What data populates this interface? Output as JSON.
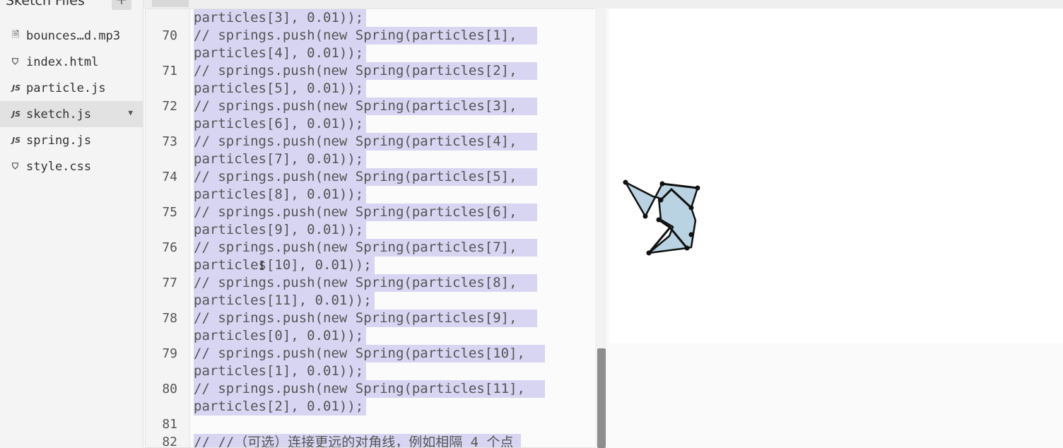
{
  "sidebar": {
    "title": "Sketch Files",
    "add_label": "+",
    "files": [
      {
        "name": "bounces…d.mp3",
        "icon": "file-icon",
        "glyph": "🗎",
        "selected": false
      },
      {
        "name": "index.html",
        "icon": "html5-icon",
        "glyph": "⛉",
        "selected": false
      },
      {
        "name": "particle.js",
        "icon": "js-icon",
        "glyph": "JS",
        "selected": false
      },
      {
        "name": "sketch.js",
        "icon": "js-icon",
        "glyph": "JS",
        "selected": true
      },
      {
        "name": "spring.js",
        "icon": "js-icon",
        "glyph": "JS",
        "selected": false
      },
      {
        "name": "style.css",
        "icon": "css3-icon",
        "glyph": "⛉",
        "selected": false
      }
    ],
    "options_glyph": "▼"
  },
  "editor": {
    "first_partial_line": "particles[3], 0.01));",
    "lines": [
      {
        "number": "70",
        "l1": "// springs.push(new Spring(particles[1],",
        "l2": "particles[4], 0.01));"
      },
      {
        "number": "71",
        "l1": "// springs.push(new Spring(particles[2],",
        "l2": "particles[5], 0.01));"
      },
      {
        "number": "72",
        "l1": "// springs.push(new Spring(particles[3],",
        "l2": "particles[6], 0.01));"
      },
      {
        "number": "73",
        "l1": "// springs.push(new Spring(particles[4],",
        "l2": "particles[7], 0.01));"
      },
      {
        "number": "74",
        "l1": "// springs.push(new Spring(particles[5],",
        "l2": "particles[8], 0.01));"
      },
      {
        "number": "75",
        "l1": "// springs.push(new Spring(particles[6],",
        "l2": "particles[9], 0.01));"
      },
      {
        "number": "76",
        "l1": "// springs.push(new Spring(particles[7],",
        "l2": "particles[10], 0.01));"
      },
      {
        "number": "77",
        "l1": "// springs.push(new Spring(particles[8],",
        "l2": "particles[11], 0.01));"
      },
      {
        "number": "78",
        "l1": "// springs.push(new Spring(particles[9],",
        "l2": "particles[0], 0.01));"
      },
      {
        "number": "79",
        "l1": "// springs.push(new Spring(particles[10],",
        "l2": "particles[1], 0.01));"
      },
      {
        "number": "80",
        "l1": "// springs.push(new Spring(particles[11],",
        "l2": "particles[2], 0.01));"
      }
    ],
    "line_81": "81",
    "line_82": {
      "number": "82",
      "text": "// //（可选）连接更远的对角线，例如相隔 4 个点"
    },
    "cursor_glyph": "I"
  },
  "preview": {
    "shape_fill": "#b9d3e3",
    "stroke": "#111111"
  },
  "colors": {
    "selection": "#d7d5f2",
    "scrollbar_thumb": "#8e8e8e",
    "sidebar_bg": "#f4f4f4"
  }
}
